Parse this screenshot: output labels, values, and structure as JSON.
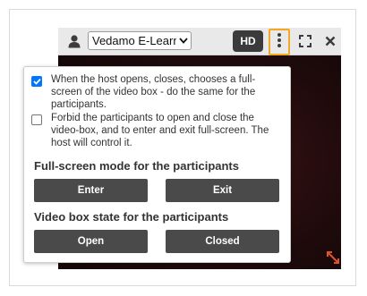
{
  "toolbar": {
    "user_icon": "user-icon",
    "room_select_value": "Vedamo E-Learning",
    "hd_label": "HD",
    "menu_icon": "vertical-dots-icon",
    "fullscreen_icon": "fullscreen-icon",
    "close_icon": "close-icon",
    "menu_highlight_color": "#f5a623"
  },
  "video": {
    "resize_icon": "diagonal-resize-icon",
    "resize_icon_color": "#e0522a"
  },
  "popup": {
    "options": [
      {
        "checked": true,
        "text": "When the host opens, closes, chooses a full-screen of the video box - do the same for the participants."
      },
      {
        "checked": false,
        "text": "Forbid the participants to open and close the video-box, and to enter and exit full-screen. The host will control it."
      }
    ],
    "fullscreen_section": {
      "title": "Full-screen mode for the participants",
      "enter_label": "Enter",
      "exit_label": "Exit"
    },
    "state_section": {
      "title": "Video box state for the participants",
      "open_label": "Open",
      "closed_label": "Closed"
    }
  }
}
